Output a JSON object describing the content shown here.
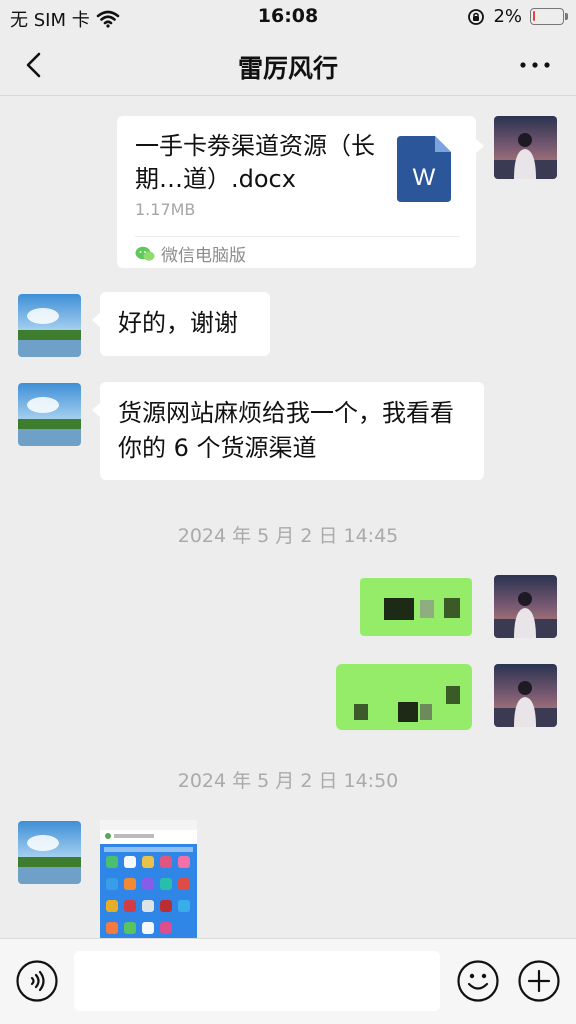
{
  "status_bar": {
    "carrier": "无 SIM 卡",
    "time": "16:08",
    "battery_percent": "2%",
    "battery_level": 0.02,
    "icons": [
      "wifi-icon",
      "orientation-lock-icon",
      "battery-icon"
    ]
  },
  "nav": {
    "title": "雷厉风行",
    "back_icon": "chevron-left-icon",
    "more_icon": "more-dots-icon"
  },
  "messages": {
    "file": {
      "name": "一手卡劵渠道资源（长期…道）.docx",
      "size": "1.17MB",
      "source": "微信电脑版",
      "icon_letter": "W"
    },
    "reply_1": "好的，谢谢",
    "reply_2": "货源网站麻烦给我一个，我看看你的 6 个货源渠道",
    "time_1": "2024 年 5 月 2 日 14:45",
    "time_2": "2024 年 5 月 2 日 14:50"
  },
  "colors": {
    "background": "#ededed",
    "my_bubble": "#95ec69",
    "other_bubble": "#ffffff",
    "word_icon": "#2b579a"
  }
}
